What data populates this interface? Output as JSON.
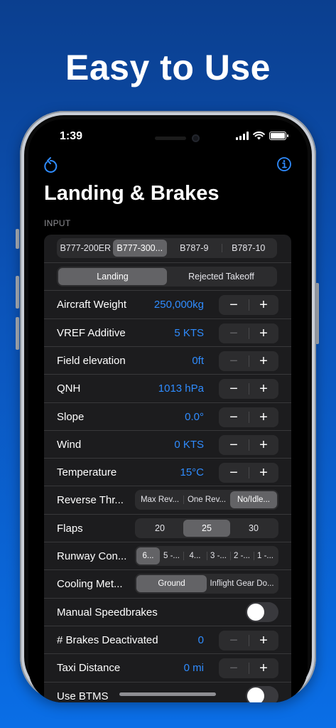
{
  "headline": "Easy to Use",
  "status": {
    "time": "1:39"
  },
  "nav": {
    "left_icon": "reset-arrow-icon",
    "right_icon": "info-icon",
    "accent": "#2f8cff"
  },
  "page_title": "Landing & Brakes",
  "section_label": "INPUT",
  "aircraft_options": [
    "B777-200ER",
    "B777-300...",
    "B787-9",
    "B787-10"
  ],
  "aircraft_selected": "B777-300...",
  "mode_options": [
    "Landing",
    "Rejected Takeoff"
  ],
  "mode_selected": "Landing",
  "rows": {
    "weight": {
      "label": "Aircraft Weight",
      "value": "250,000kg"
    },
    "vref": {
      "label": "VREF Additive",
      "value": "5 KTS"
    },
    "elevation": {
      "label": "Field elevation",
      "value": "0ft"
    },
    "qnh": {
      "label": "QNH",
      "value": "1013 hPa"
    },
    "slope": {
      "label": "Slope",
      "value": "0.0°"
    },
    "wind": {
      "label": "Wind",
      "value": "0 KTS"
    },
    "temperature": {
      "label": "Temperature",
      "value": "15°C"
    },
    "reverse": {
      "label": "Reverse Thr...",
      "options": [
        "Max Rev...",
        "One Rev...",
        "No/Idle..."
      ],
      "selected": "No/Idle..."
    },
    "flaps": {
      "label": "Flaps",
      "options": [
        "20",
        "25",
        "30"
      ],
      "selected": "25"
    },
    "runway": {
      "label": "Runway Con...",
      "options": [
        "6...",
        "5 -...",
        "4...",
        "3 -...",
        "2 -...",
        "1 -..."
      ],
      "selected": "6..."
    },
    "cooling": {
      "label": "Cooling Met...",
      "options": [
        "Ground",
        "Inflight Gear Do..."
      ],
      "selected": "Ground"
    },
    "speedbrakes": {
      "label": "Manual Speedbrakes",
      "on": false
    },
    "brakes": {
      "label": "# Brakes Deactivated",
      "value": "0"
    },
    "taxi": {
      "label": "Taxi Distance",
      "value": "0 mi"
    },
    "btms": {
      "label": "Use BTMS",
      "on": false
    }
  },
  "stepper": {
    "minus": "−",
    "plus": "+"
  }
}
